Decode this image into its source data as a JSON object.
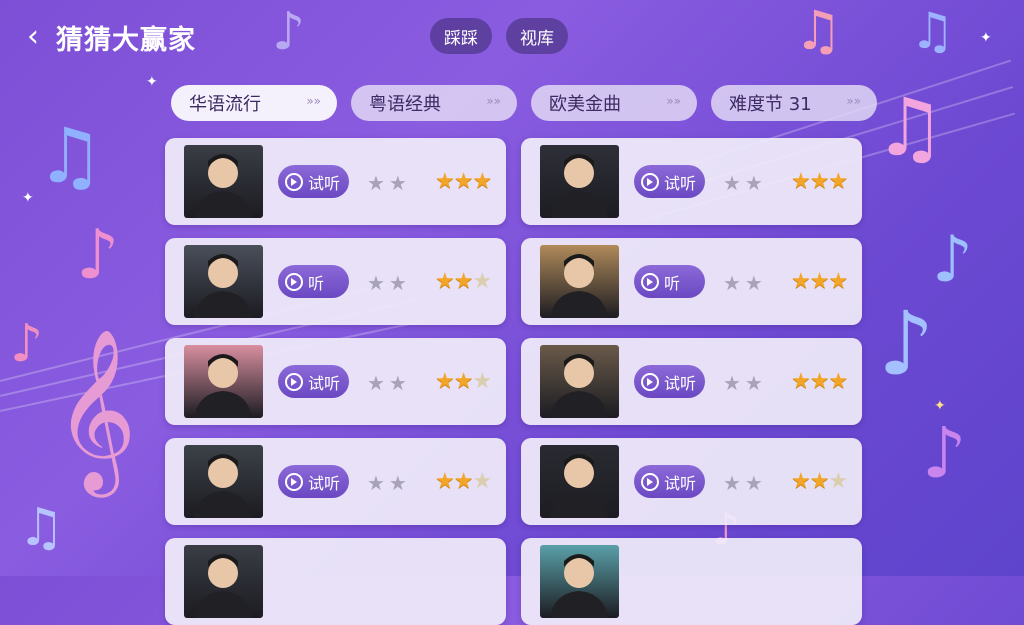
{
  "header": {
    "title": "猜猜大赢家",
    "tabs": [
      "踩踩",
      "视库"
    ]
  },
  "categories": [
    {
      "label": "华语流行",
      "active": true
    },
    {
      "label": "粤语经典",
      "active": false
    },
    {
      "label": "欧美金曲",
      "active": false
    },
    {
      "label": "难度节 31",
      "active": false
    }
  ],
  "cards": [
    {
      "listen_label": "试听",
      "avatar_color": "#3a3d45",
      "rating": 3
    },
    {
      "listen_label": "试听",
      "avatar_color": "#2e2f38",
      "rating": 3
    },
    {
      "listen_label": "听",
      "avatar_color": "#4a4f5a",
      "rating": 2.5
    },
    {
      "listen_label": "听",
      "avatar_color": "#b08a5a",
      "rating": 3
    },
    {
      "listen_label": "试听",
      "avatar_color": "#d88fa0",
      "rating": 2.5
    },
    {
      "listen_label": "试听",
      "avatar_color": "#6a5a4a",
      "rating": 3
    },
    {
      "listen_label": "试听",
      "avatar_color": "#3c4148",
      "rating": 2.5
    },
    {
      "listen_label": "试听",
      "avatar_color": "#2a2a32",
      "rating": 2.5
    },
    {
      "listen_label": "",
      "avatar_color": "#3a3d45",
      "rating": 0
    },
    {
      "listen_label": "",
      "avatar_color": "#5aa0a8",
      "rating": 0
    }
  ],
  "colors": {
    "accent": "#6b48c2",
    "star": "#f2a526",
    "card_bg": "#f0ecfa"
  }
}
